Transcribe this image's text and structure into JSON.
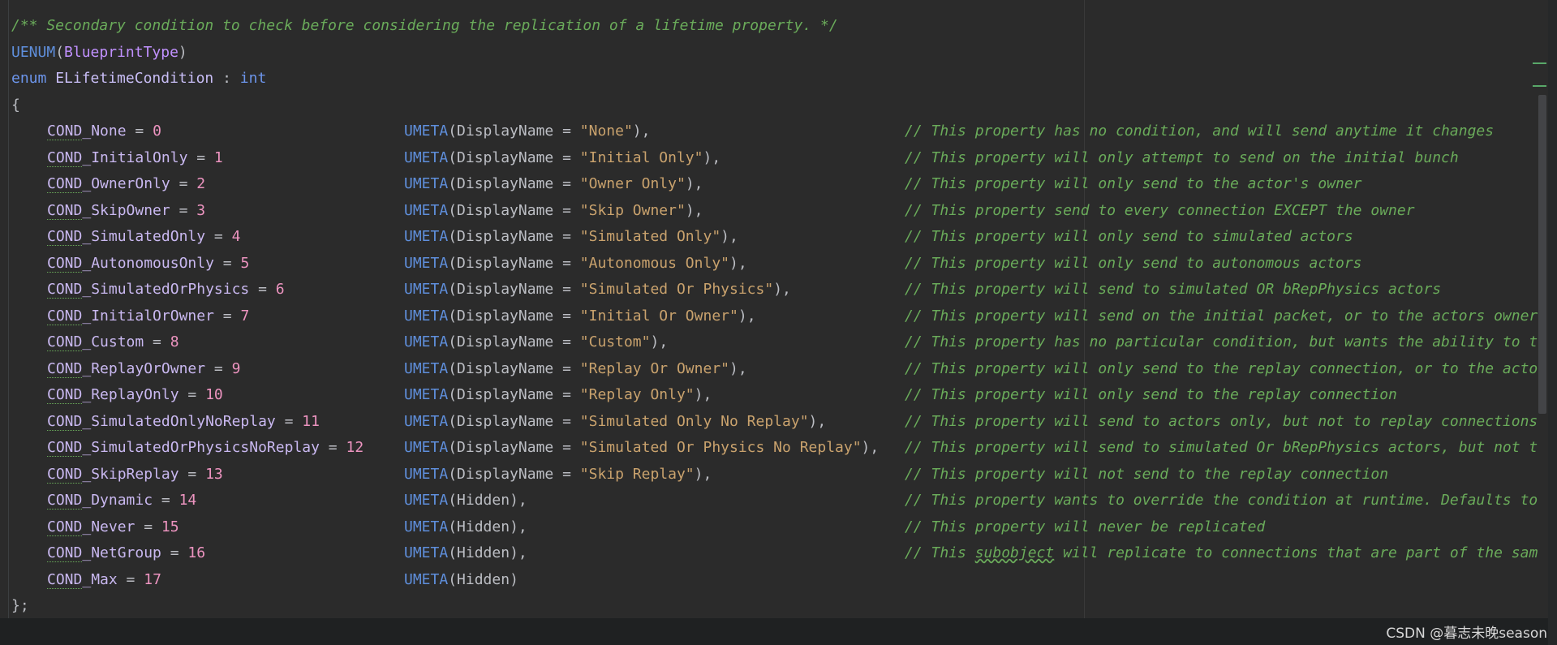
{
  "header_comment": "/** Secondary condition to check before considering the replication of a lifetime property. */",
  "uenum": {
    "macro": "UENUM",
    "arg": "BlueprintType"
  },
  "enum_decl": {
    "keyword": "enum",
    "name": "ELifetimeCondition",
    "sep": " : ",
    "base": "int"
  },
  "open_brace": "{",
  "close_brace": "};",
  "members": [
    {
      "name": "COND_None",
      "value": "0",
      "meta": "DisplayName",
      "display": "\"None\"",
      "end": ",",
      "comment": "// This property has no condition, and will send anytime it changes"
    },
    {
      "name": "COND_InitialOnly",
      "value": "1",
      "meta": "DisplayName",
      "display": "\"Initial Only\"",
      "end": ",",
      "comment": "// This property will only attempt to send on the initial bunch"
    },
    {
      "name": "COND_OwnerOnly",
      "value": "2",
      "meta": "DisplayName",
      "display": "\"Owner Only\"",
      "end": ",",
      "comment": "// This property will only send to the actor's owner"
    },
    {
      "name": "COND_SkipOwner",
      "value": "3",
      "meta": "DisplayName",
      "display": "\"Skip Owner\"",
      "end": ",",
      "comment": "// This property send to every connection EXCEPT the owner"
    },
    {
      "name": "COND_SimulatedOnly",
      "value": "4",
      "meta": "DisplayName",
      "display": "\"Simulated Only\"",
      "end": ",",
      "comment": "// This property will only send to simulated actors"
    },
    {
      "name": "COND_AutonomousOnly",
      "value": "5",
      "meta": "DisplayName",
      "display": "\"Autonomous Only\"",
      "end": ",",
      "comment": "// This property will only send to autonomous actors"
    },
    {
      "name": "COND_SimulatedOrPhysics",
      "value": "6",
      "meta": "DisplayName",
      "display": "\"Simulated Or Physics\"",
      "end": ",",
      "comment": "// This property will send to simulated OR bRepPhysics actors"
    },
    {
      "name": "COND_InitialOrOwner",
      "value": "7",
      "meta": "DisplayName",
      "display": "\"Initial Or Owner\"",
      "end": ",",
      "comment": "// This property will send on the initial packet, or to the actors owner"
    },
    {
      "name": "COND_Custom",
      "value": "8",
      "meta": "DisplayName",
      "display": "\"Custom\"",
      "end": ",",
      "comment": "// This property has no particular condition, but wants the ability to t"
    },
    {
      "name": "COND_ReplayOrOwner",
      "value": "9",
      "meta": "DisplayName",
      "display": "\"Replay Or Owner\"",
      "end": ",",
      "comment": "// This property will only send to the replay connection, or to the acto"
    },
    {
      "name": "COND_ReplayOnly",
      "value": "10",
      "meta": "DisplayName",
      "display": "\"Replay Only\"",
      "end": ",",
      "comment": "// This property will only send to the replay connection"
    },
    {
      "name": "COND_SimulatedOnlyNoReplay",
      "value": "11",
      "meta": "DisplayName",
      "display": "\"Simulated Only No Replay\"",
      "end": ",",
      "comment": "// This property will send to actors only, but not to replay connections"
    },
    {
      "name": "COND_SimulatedOrPhysicsNoReplay",
      "value": "12",
      "meta": "DisplayName",
      "display": "\"Simulated Or Physics No Replay\"",
      "end": ",",
      "comment": "// This property will send to simulated Or bRepPhysics actors, but not t"
    },
    {
      "name": "COND_SkipReplay",
      "value": "13",
      "meta": "DisplayName",
      "display": "\"Skip Replay\"",
      "end": ",",
      "comment": "// This property will not send to the replay connection"
    },
    {
      "name": "COND_Dynamic",
      "value": "14",
      "meta": "Hidden",
      "display": "",
      "end": ",",
      "comment": "// This property wants to override the condition at runtime. Defaults to"
    },
    {
      "name": "COND_Never",
      "value": "15",
      "meta": "Hidden",
      "display": "",
      "end": ",",
      "comment": "// This property will never be replicated"
    },
    {
      "name": "COND_NetGroup",
      "value": "16",
      "meta": "Hidden",
      "display": "",
      "end": ",",
      "comment": "// This subobject will replicate to connections that are part of the sam"
    },
    {
      "name": "COND_Max",
      "value": "17",
      "meta": "Hidden",
      "display": "",
      "end": "",
      "comment": ""
    }
  ],
  "meta_macro": "UMETA",
  "watermark": "CSDN @暮志未晚season",
  "colors": {
    "background": "#2b2b2b",
    "comment": "#6aab5a",
    "macro": "#5f8fdc",
    "number": "#ed94c0",
    "string": "#c9a26d"
  }
}
